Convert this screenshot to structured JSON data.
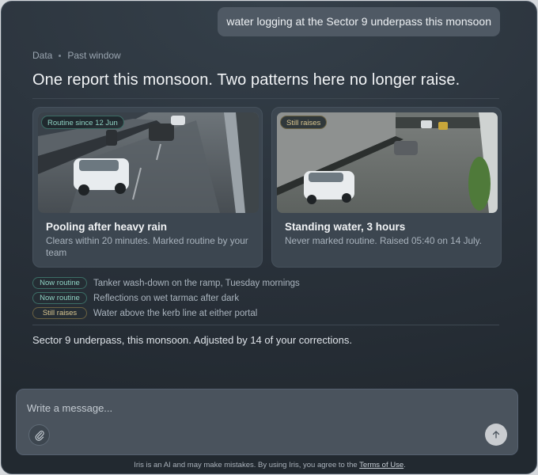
{
  "user_message": "water logging at the Sector 9 underpass this monsoon",
  "breadcrumb": {
    "first": "Data",
    "second": "Past window"
  },
  "headline": "One report this monsoon. Two patterns here no longer raise.",
  "cards": [
    {
      "tag": "Routine since 12 Jun",
      "tag_kind": "routine",
      "title": "Pooling after heavy rain",
      "text": "Clears within 20 minutes. Marked routine by your team"
    },
    {
      "tag": "Still raises",
      "tag_kind": "raises",
      "title": "Standing water, 3 hours",
      "text": "Never marked routine. Raised 05:40 on 14 July."
    }
  ],
  "legend": [
    {
      "status": "Now routine",
      "kind": "routine",
      "text": "Tanker wash-down on the ramp, Tuesday mornings"
    },
    {
      "status": "Now routine",
      "kind": "routine",
      "text": "Reflections on wet tarmac after dark"
    },
    {
      "status": "Still raises",
      "kind": "raises",
      "text": "Water above the kerb line at either portal"
    }
  ],
  "summary": "Sector 9 underpass, this monsoon. Adjusted by 14 of your corrections.",
  "composer": {
    "placeholder": "Write a message...",
    "attach_icon": "paperclip-icon",
    "send_icon": "arrow-up-icon"
  },
  "disclaimer": {
    "prefix": "Iris is an AI and may make mistakes. By using Iris, you agree to the ",
    "link": "Terms of Use",
    "suffix": "."
  },
  "colors": {
    "routine": "#8fd3c4",
    "raises": "#d9c690",
    "background": "#2a323b"
  }
}
